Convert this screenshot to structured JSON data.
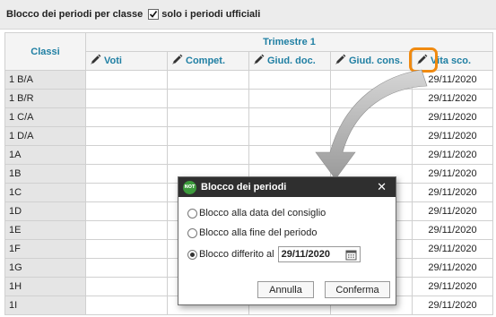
{
  "toolbar": {
    "title": "Blocco dei periodi per classe",
    "checkbox_checked": true,
    "checkbox_label": "solo i periodi ufficiali"
  },
  "table": {
    "classi_header": "Classi",
    "period_header": "Trimestre 1",
    "columns": [
      "Voti",
      "Compet.",
      "Giud. doc.",
      "Giud. cons.",
      "Vita sco."
    ],
    "rows": [
      {
        "classe": "1 B/A",
        "vita": "29/11/2020"
      },
      {
        "classe": "1 B/R",
        "vita": "29/11/2020"
      },
      {
        "classe": "1 C/A",
        "vita": "29/11/2020"
      },
      {
        "classe": "1 D/A",
        "vita": "29/11/2020"
      },
      {
        "classe": "1A",
        "vita": "29/11/2020"
      },
      {
        "classe": "1B",
        "vita": "29/11/2020"
      },
      {
        "classe": "1C",
        "vita": "29/11/2020"
      },
      {
        "classe": "1D",
        "vita": "29/11/2020"
      },
      {
        "classe": "1E",
        "vita": "29/11/2020"
      },
      {
        "classe": "1F",
        "vita": "29/11/2020"
      },
      {
        "classe": "1G",
        "vita": "29/11/2020"
      },
      {
        "classe": "1H",
        "vita": "29/11/2020"
      },
      {
        "classe": "1I",
        "vita": "29/11/2020"
      }
    ]
  },
  "dialog": {
    "icon_text": "NOT",
    "title": "Blocco dei periodi",
    "close": "✕",
    "options": [
      {
        "label": "Blocco alla data del consiglio",
        "selected": false
      },
      {
        "label": "Blocco alla fine del periodo",
        "selected": false
      },
      {
        "label": "Blocco differito al",
        "selected": true
      }
    ],
    "date_value": "29/11/2020",
    "cancel_label": "Annulla",
    "confirm_label": "Conferma"
  },
  "colors": {
    "header_text": "#1f7fa3",
    "highlight": "#f08a10",
    "dialog_title_bg": "#2f2f2f",
    "not_icon_bg": "#3c9a3c"
  }
}
